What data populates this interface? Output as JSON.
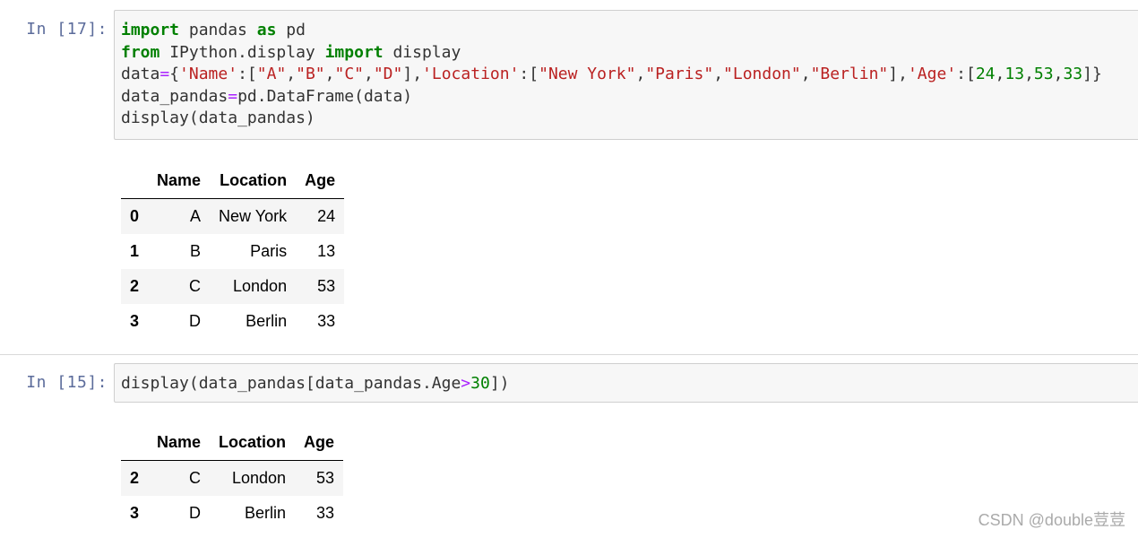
{
  "cells": [
    {
      "prompt": "In  [17]:",
      "code_lines": [
        [
          {
            "t": "import",
            "c": "kw"
          },
          {
            "t": " pandas "
          },
          {
            "t": "as",
            "c": "kw"
          },
          {
            "t": " pd"
          }
        ],
        [
          {
            "t": "from",
            "c": "kw"
          },
          {
            "t": " IPython.display "
          },
          {
            "t": "import",
            "c": "kw"
          },
          {
            "t": " display"
          }
        ],
        [
          {
            "t": "data"
          },
          {
            "t": "=",
            "c": "op"
          },
          {
            "t": "{"
          },
          {
            "t": "'Name'",
            "c": "str"
          },
          {
            "t": ":["
          },
          {
            "t": "\"A\"",
            "c": "str"
          },
          {
            "t": ","
          },
          {
            "t": "\"B\"",
            "c": "str"
          },
          {
            "t": ","
          },
          {
            "t": "\"C\"",
            "c": "str"
          },
          {
            "t": ","
          },
          {
            "t": "\"D\"",
            "c": "str"
          },
          {
            "t": "],"
          },
          {
            "t": "'Location'",
            "c": "str"
          },
          {
            "t": ":["
          },
          {
            "t": "\"New York\"",
            "c": "str"
          },
          {
            "t": ","
          },
          {
            "t": "\"Paris\"",
            "c": "str"
          },
          {
            "t": ","
          },
          {
            "t": "\"London\"",
            "c": "str"
          },
          {
            "t": ","
          },
          {
            "t": "\"Berlin\"",
            "c": "str"
          },
          {
            "t": "],"
          },
          {
            "t": "'Age'",
            "c": "str"
          },
          {
            "t": ":["
          },
          {
            "t": "24",
            "c": "num"
          },
          {
            "t": ","
          },
          {
            "t": "13",
            "c": "num"
          },
          {
            "t": ","
          },
          {
            "t": "53",
            "c": "num"
          },
          {
            "t": ","
          },
          {
            "t": "33",
            "c": "num"
          },
          {
            "t": "]}"
          }
        ],
        [
          {
            "t": "data_pandas"
          },
          {
            "t": "=",
            "c": "op"
          },
          {
            "t": "pd.DataFrame(data)"
          }
        ],
        [
          {
            "t": "display(data_pandas)"
          }
        ]
      ],
      "output_table": {
        "columns": [
          "",
          "Name",
          "Location",
          "Age"
        ],
        "rows": [
          [
            "0",
            "A",
            "New York",
            "24"
          ],
          [
            "1",
            "B",
            "Paris",
            "13"
          ],
          [
            "2",
            "C",
            "London",
            "53"
          ],
          [
            "3",
            "D",
            "Berlin",
            "33"
          ]
        ]
      }
    },
    {
      "prompt": "In  [15]:",
      "code_lines": [
        [
          {
            "t": "display(data_pandas[data_pandas.Age"
          },
          {
            "t": ">",
            "c": "op"
          },
          {
            "t": "30",
            "c": "num"
          },
          {
            "t": "])"
          }
        ]
      ],
      "output_table": {
        "columns": [
          "",
          "Name",
          "Location",
          "Age"
        ],
        "rows": [
          [
            "2",
            "C",
            "London",
            "53"
          ],
          [
            "3",
            "D",
            "Berlin",
            "33"
          ]
        ]
      }
    }
  ],
  "watermark": "CSDN @double荳荳"
}
